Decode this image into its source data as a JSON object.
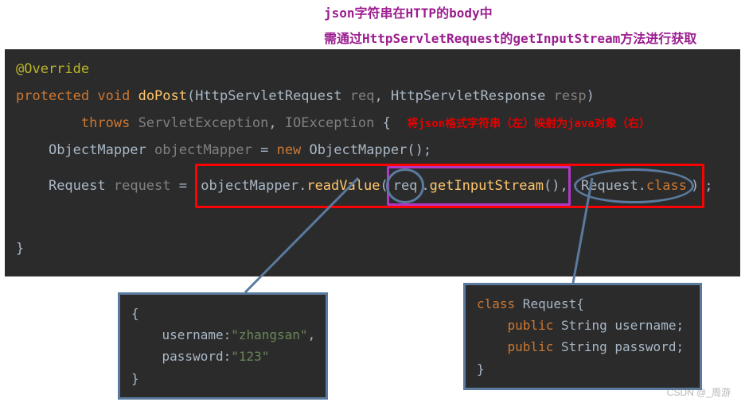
{
  "header_note": {
    "line1": "json字符串在HTTP的body中",
    "line2": "需通过HttpServletRequest的getInputStream方法进行获取"
  },
  "code": {
    "anno_override": "@Override",
    "kw_protected": "protected",
    "kw_void": "void",
    "m_doPost": "doPost",
    "t_hsr": "HttpServletRequest",
    "p_req": "req",
    "t_hsresp": "HttpServletResponse",
    "p_resp": "resp",
    "kw_throws": "throws",
    "t_se": "ServletException",
    "t_ioe": "IOException",
    "brace_open": "{",
    "red_note_inline": "将json格式字符串（左）映射为java对象（右）",
    "t_om": "ObjectMapper",
    "v_objectMapper": "objectMapper",
    "kw_new": "new",
    "ctor_om": "ObjectMapper",
    "paren_empty": "()",
    "t_request": "Request",
    "v_request": "request",
    "eq": "=",
    "readValue_obj": "objectMapper.",
    "readValue_method": "readValue",
    "paren_o": "(",
    "req_ident": "req",
    "dot": ".",
    "getInputStream": "getInputStream",
    "paren_c_comma": "(),",
    "space": " ",
    "Request_class": "Request.",
    "kw_class": "class",
    "paren_close": ")",
    "semi": ";",
    "brace_close": "}"
  },
  "callout_left": {
    "l1": "{",
    "l2": "    username:",
    "l2v": "\"zhangsan\"",
    "l2c": ",",
    "l3": "    password:",
    "l3v": "\"123\"",
    "l4": "}"
  },
  "callout_right": {
    "l1_kw": "class",
    "l1_name": " Request{",
    "l2_kw": "public",
    "l2_type": " String ",
    "l2_name": "username;",
    "l3_kw": "public",
    "l3_type": " String ",
    "l3_name": "password;",
    "l4": "}"
  },
  "watermark": "CSDN @_周游"
}
